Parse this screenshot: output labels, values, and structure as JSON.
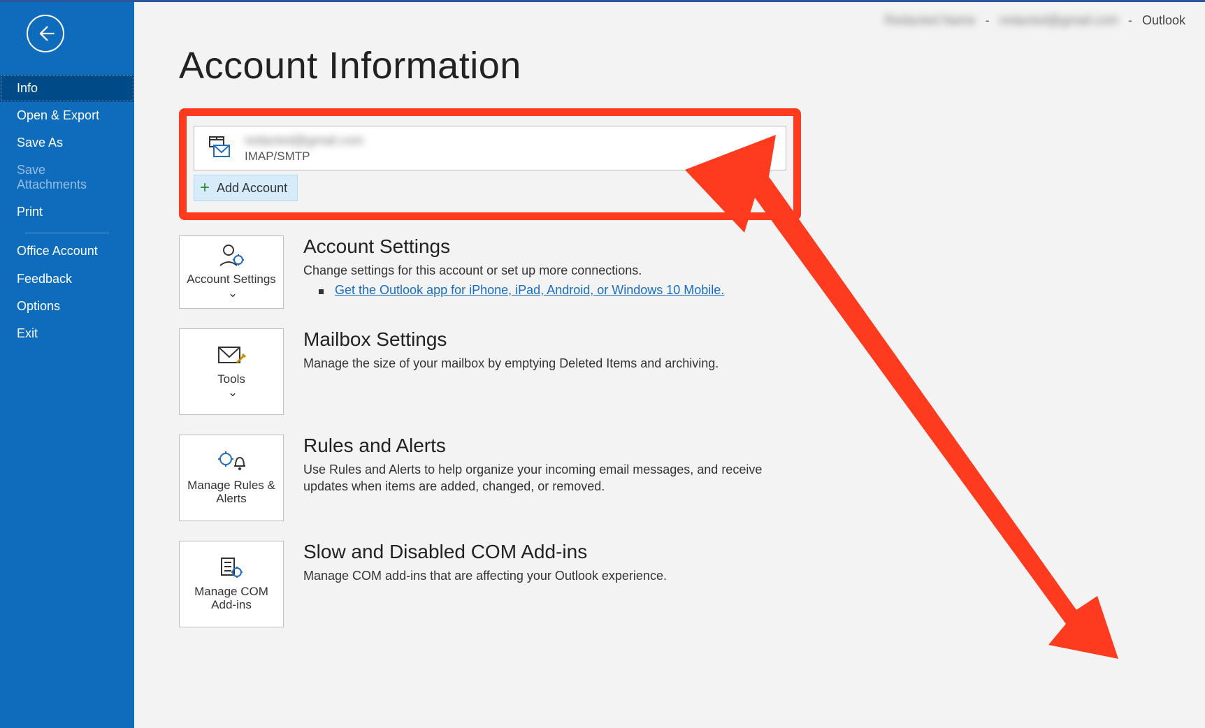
{
  "titlebar": {
    "account_name_blurred": "Redacted Name",
    "email_blurred": "redacted@gmail.com",
    "app_name": "Outlook"
  },
  "sidebar": {
    "items": [
      {
        "label": "Info",
        "selected": true
      },
      {
        "label": "Open & Export"
      },
      {
        "label": "Save As"
      },
      {
        "label": "Save Attachments",
        "disabled": true
      },
      {
        "label": "Print"
      }
    ],
    "lower_items": [
      {
        "label": "Office Account"
      },
      {
        "label": "Feedback"
      },
      {
        "label": "Options"
      },
      {
        "label": "Exit"
      }
    ]
  },
  "page": {
    "title": "Account Information"
  },
  "account_box": {
    "email_blurred": "redacted@gmail.com",
    "type": "IMAP/SMTP",
    "add_account_label": "Add Account"
  },
  "sections": {
    "account_settings": {
      "tile_label": "Account Settings",
      "heading": "Account Settings",
      "desc": "Change settings for this account or set up more connections.",
      "link": "Get the Outlook app for iPhone, iPad, Android, or Windows 10 Mobile."
    },
    "mailbox": {
      "tile_label": "Tools",
      "heading": "Mailbox Settings",
      "desc": "Manage the size of your mailbox by emptying Deleted Items and archiving."
    },
    "rules": {
      "tile_label": "Manage Rules & Alerts",
      "heading": "Rules and Alerts",
      "desc": "Use Rules and Alerts to help organize your incoming email messages, and receive updates when items are added, changed, or removed."
    },
    "com": {
      "tile_label": "Manage COM Add-ins",
      "heading": "Slow and Disabled COM Add-ins",
      "desc": "Manage COM add-ins that are affecting your Outlook experience."
    }
  }
}
